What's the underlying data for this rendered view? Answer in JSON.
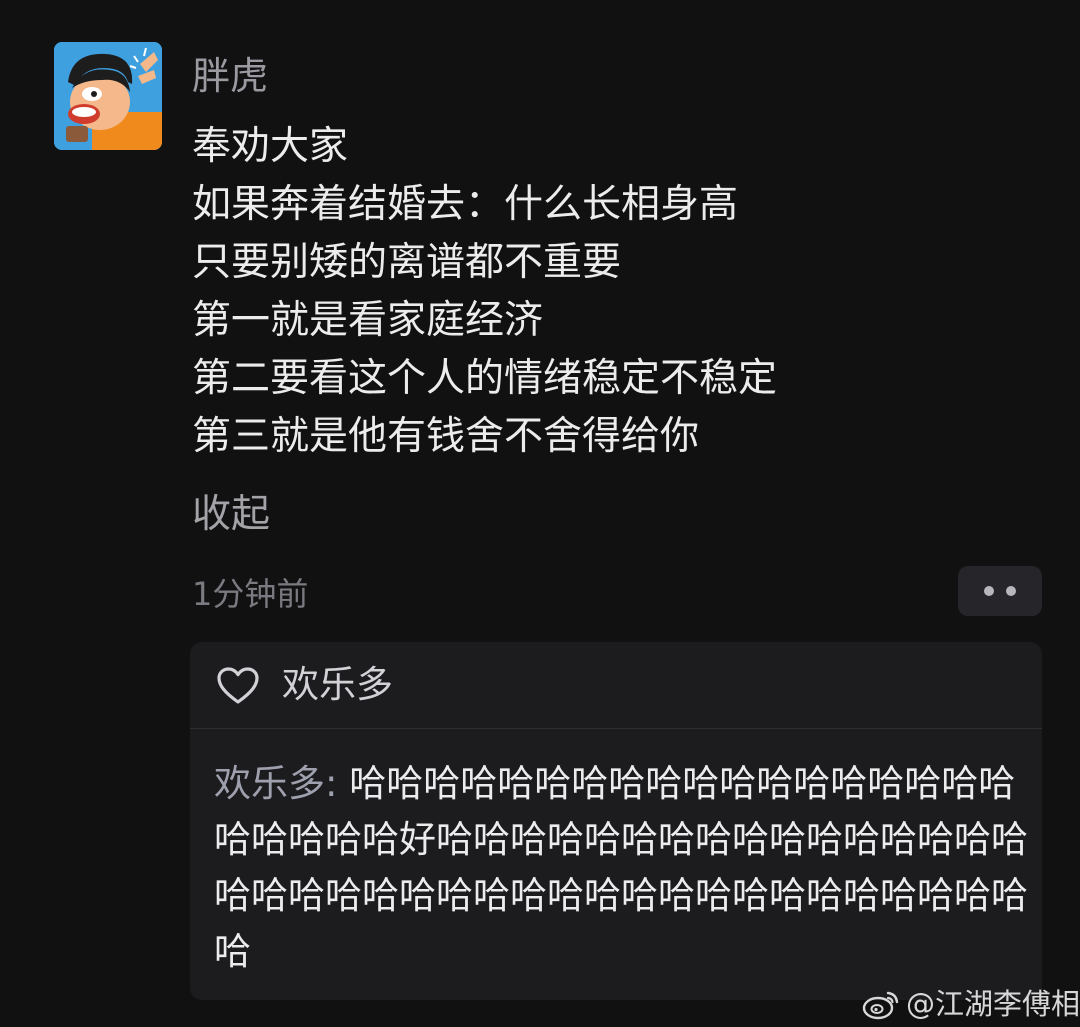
{
  "post": {
    "username": "胖虎",
    "lines": [
      "奉劝大家",
      "如果奔着结婚去：什么长相身高",
      "只要别矮的离谱都不重要",
      "第一就是看家庭经济",
      "第二要看这个人的情绪稳定不稳定",
      "第三就是他有钱舍不舍得给你"
    ],
    "collapse_label": "收起",
    "timestamp": "1分钟前",
    "avatar_icon": "cartoon-avatar-icon",
    "more_icon": "more-dots-icon"
  },
  "comment_section": {
    "likes": {
      "icon": "heart-outline-icon",
      "user": "欢乐多"
    },
    "comment": {
      "author": "欢乐多:",
      "text": "哈哈哈哈哈哈哈哈哈哈哈哈哈哈哈哈哈哈哈哈哈哈哈好哈哈哈哈哈哈哈哈哈哈哈哈哈哈哈哈哈哈哈哈哈哈哈哈哈哈哈哈哈哈哈哈哈哈哈哈哈哈哈"
    }
  },
  "watermark": {
    "icon": "weibo-logo-icon",
    "text": "@江湖李傅相"
  },
  "colors": {
    "background": "#111112",
    "card": "#1c1c1f",
    "primary_text": "#ececec",
    "muted_text": "#9a9aa0"
  }
}
